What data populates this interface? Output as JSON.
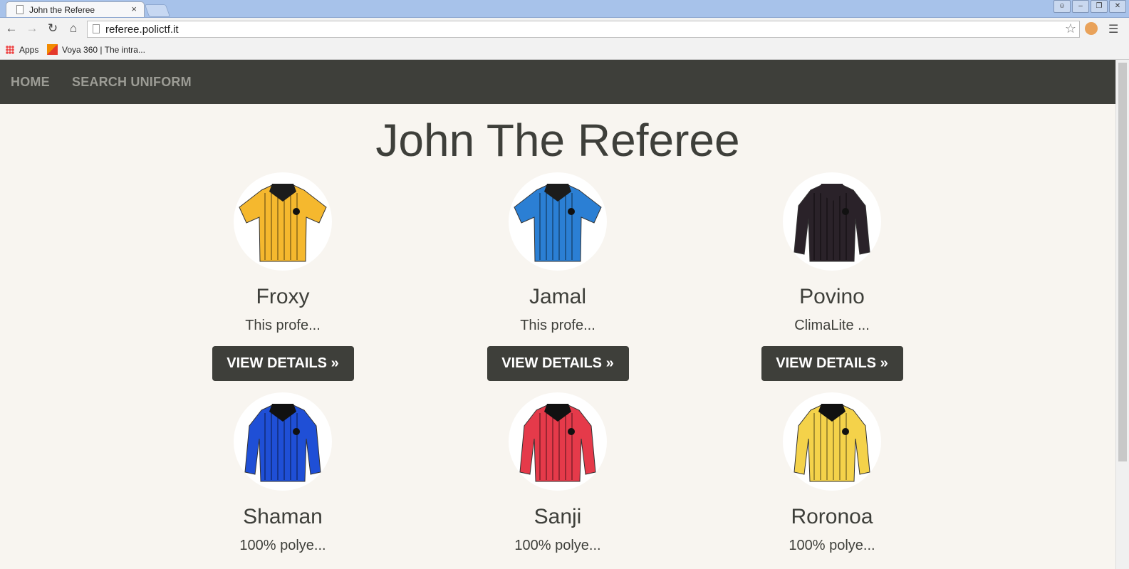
{
  "browser": {
    "tab_title": "John the Referee",
    "tab_close": "×",
    "url": "referee.polictf.it",
    "bookmarks": [
      {
        "label": "Apps"
      },
      {
        "label": "Voya 360 | The intra..."
      }
    ]
  },
  "navbar": {
    "links": [
      {
        "label": "HOME"
      },
      {
        "label": "SEARCH UNIFORM"
      }
    ]
  },
  "page": {
    "title": "John The Referee",
    "button_label": "VIEW DETAILS »",
    "items": [
      {
        "name": "Froxy",
        "desc": "This profe...",
        "color": "#f5b82e",
        "collar": "#1c1c1c",
        "sleeves": "short"
      },
      {
        "name": "Jamal",
        "desc": "This profe...",
        "color": "#2b7fd4",
        "collar": "#1c1c1c",
        "sleeves": "short"
      },
      {
        "name": "Povino",
        "desc": "ClimaLite ...",
        "color": "#2a2229",
        "collar": "#2a2229",
        "sleeves": "long"
      },
      {
        "name": "Shaman",
        "desc": "100% polye...",
        "color": "#1f4fd6",
        "collar": "#111111",
        "sleeves": "long"
      },
      {
        "name": "Sanji",
        "desc": "100% polye...",
        "color": "#e53a4a",
        "collar": "#111111",
        "sleeves": "long"
      },
      {
        "name": "Roronoa",
        "desc": "100% polye...",
        "color": "#f4d24a",
        "collar": "#111111",
        "sleeves": "long"
      }
    ]
  }
}
